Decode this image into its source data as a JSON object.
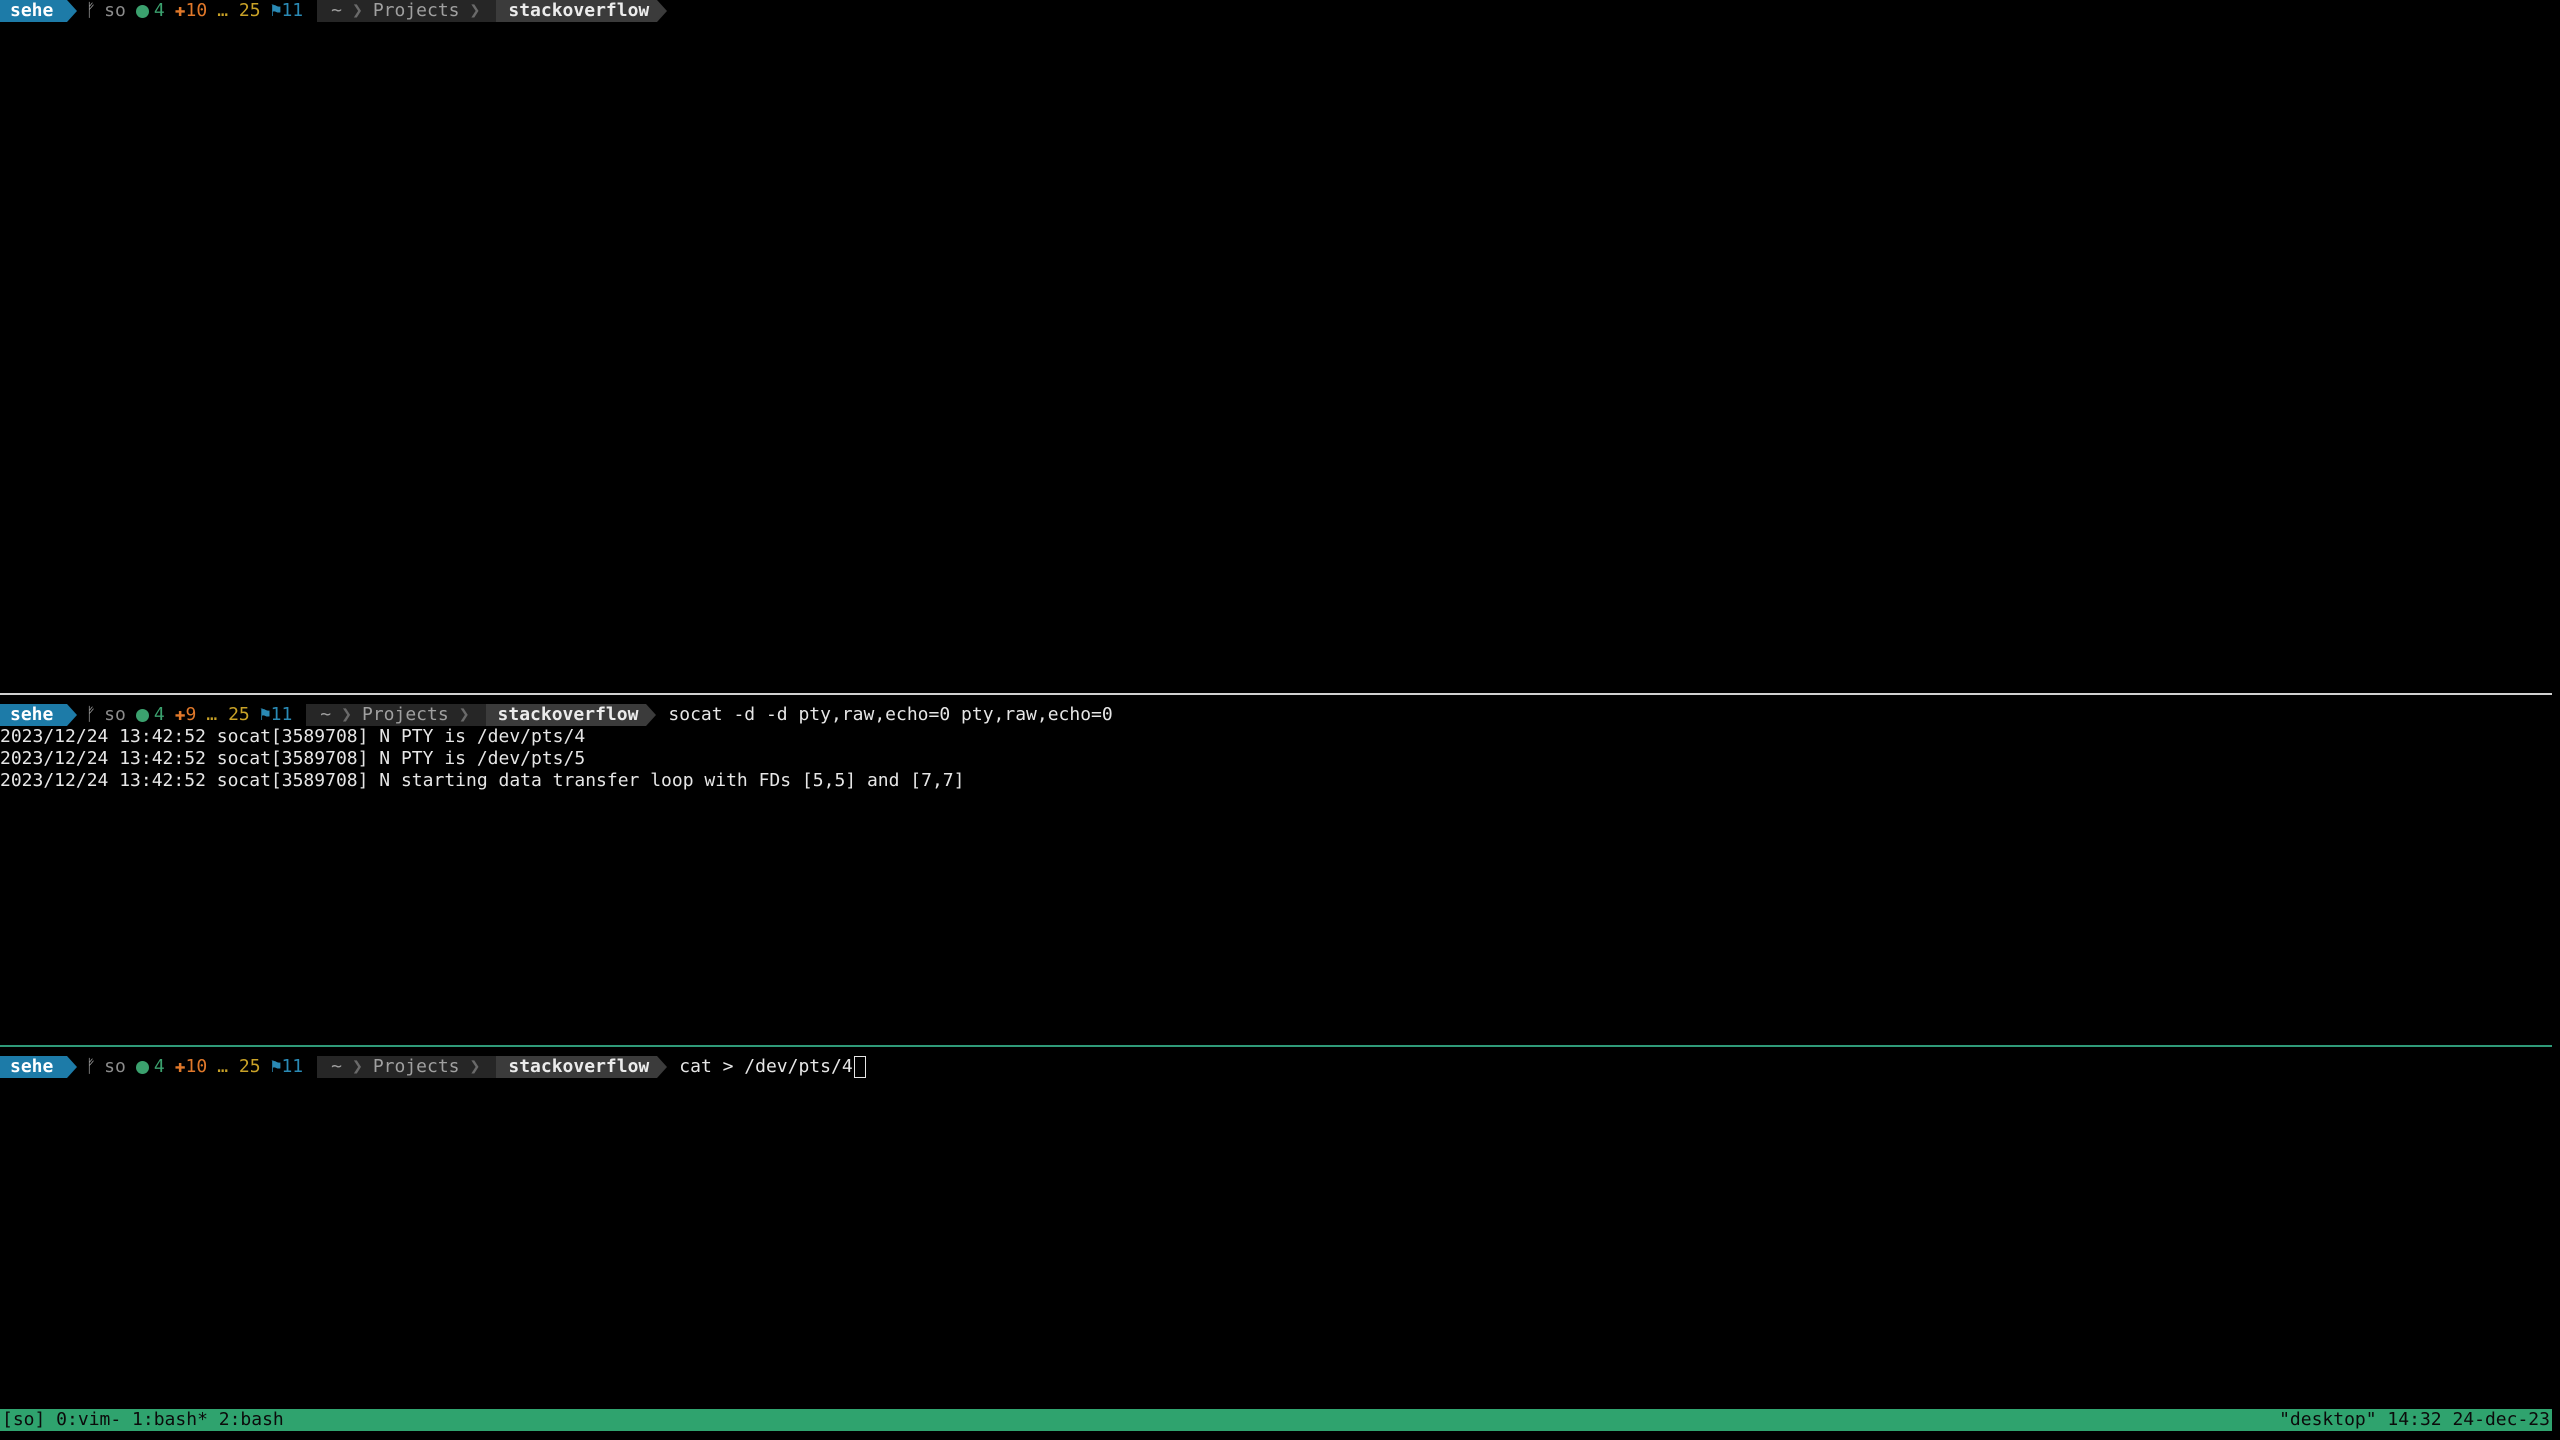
{
  "panes": {
    "top": {
      "prompt": {
        "user": "sehe",
        "branch_icon": "git-branch-icon",
        "branch": "so",
        "staged": "4",
        "modified": "10",
        "untracked_prefix": "…",
        "untracked": "25",
        "stash_icon": "flag-icon",
        "stash": "11",
        "path_home": "~",
        "path_dir": "Projects",
        "path_repo": "stackoverflow"
      }
    },
    "middle": {
      "prompt": {
        "user": "sehe",
        "branch": "so",
        "staged": "4",
        "modified": "9",
        "untracked_prefix": "…",
        "untracked": "25",
        "stash": "11",
        "path_home": "~",
        "path_dir": "Projects",
        "path_repo": "stackoverflow",
        "command": "socat -d -d pty,raw,echo=0 pty,raw,echo=0"
      },
      "output": [
        "2023/12/24 13:42:52 socat[3589708] N PTY is /dev/pts/4",
        "2023/12/24 13:42:52 socat[3589708] N PTY is /dev/pts/5",
        "2023/12/24 13:42:52 socat[3589708] N starting data transfer loop with FDs [5,5] and [7,7]"
      ]
    },
    "bottom": {
      "prompt": {
        "user": "sehe",
        "branch": "so",
        "staged": "4",
        "modified": "10",
        "untracked_prefix": "…",
        "untracked": "25",
        "stash": "11",
        "path_home": "~",
        "path_dir": "Projects",
        "path_repo": "stackoverflow",
        "command": "cat > /dev/pts/4"
      }
    }
  },
  "status_bar": {
    "left": "[so] 0:vim- 1:bash* 2:bash",
    "right": "\"desktop\" 14:32 24-dec-23"
  },
  "colors": {
    "user_segment": "#1d7ba8",
    "status_bar": "#2fa36e",
    "staged": "#3ba16e",
    "modified": "#e0782a",
    "untracked": "#c9a227",
    "stash": "#2a8ab5"
  }
}
